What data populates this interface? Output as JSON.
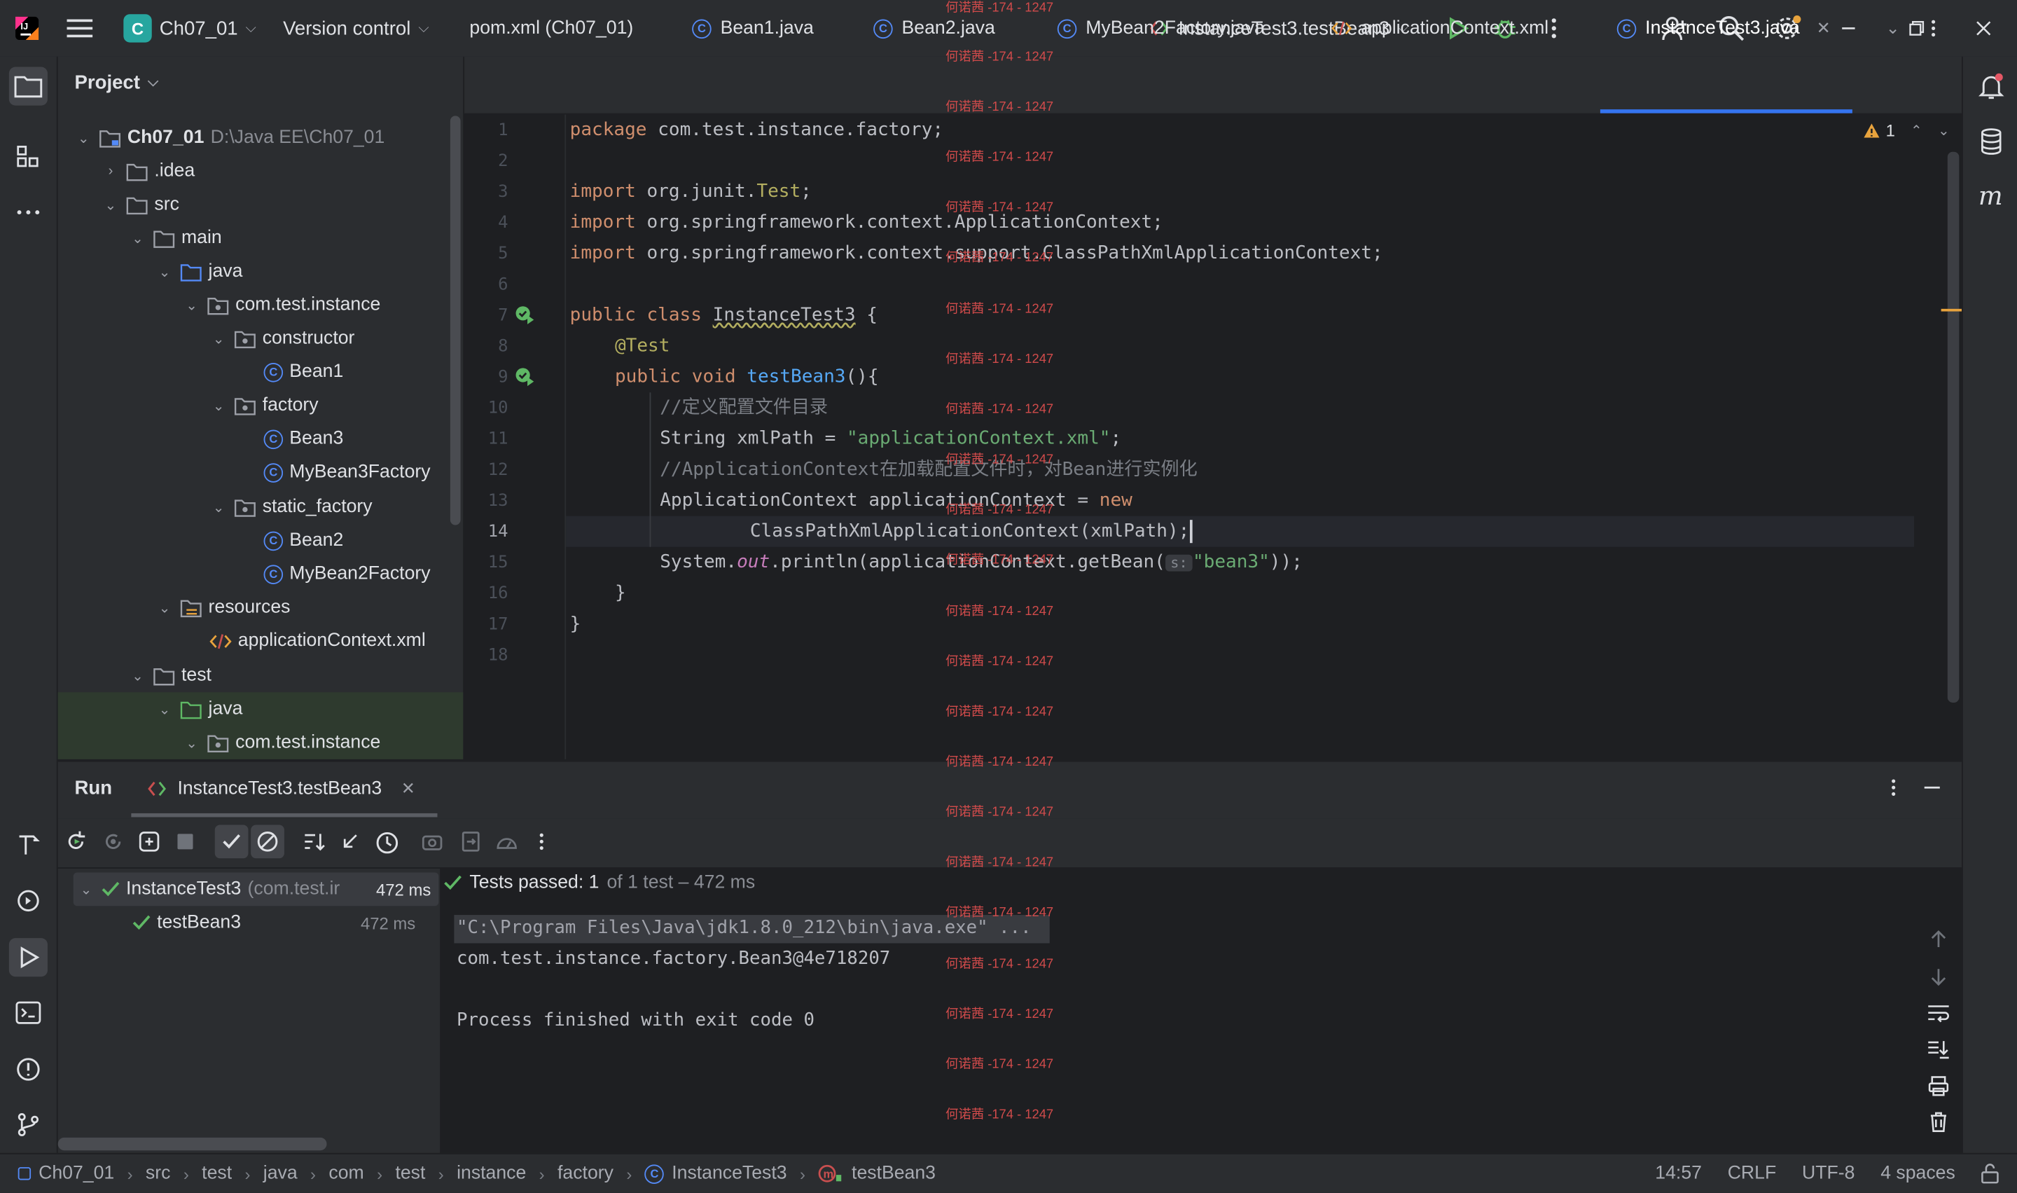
{
  "title_bar": {
    "project_badge": "C",
    "project_name": "Ch07_01",
    "vcs_label": "Version control",
    "run_config": "InstanceTest3.testBean3"
  },
  "project_panel": {
    "title": "Project",
    "tree": [
      {
        "label": "Ch07_01",
        "path": "D:\\Java EE\\Ch07_01"
      },
      {
        "label": ".idea"
      },
      {
        "label": "src"
      },
      {
        "label": "main"
      },
      {
        "label": "java"
      },
      {
        "label": "com.test.instance"
      },
      {
        "label": "constructor"
      },
      {
        "label": "Bean1"
      },
      {
        "label": "factory"
      },
      {
        "label": "Bean3"
      },
      {
        "label": "MyBean3Factory"
      },
      {
        "label": "static_factory"
      },
      {
        "label": "Bean2"
      },
      {
        "label": "MyBean2Factory"
      },
      {
        "label": "resources"
      },
      {
        "label": "applicationContext.xml"
      },
      {
        "label": "test"
      },
      {
        "label": "java"
      },
      {
        "label": "com.test.instance"
      }
    ]
  },
  "tabs": [
    {
      "label": "pom.xml (Ch07_01)"
    },
    {
      "label": "Bean1.java"
    },
    {
      "label": "Bean2.java"
    },
    {
      "label": "MyBean2Factory.java"
    },
    {
      "label": "applicationContext.xml"
    },
    {
      "label": "InstanceTest3.java"
    }
  ],
  "editor": {
    "warning_count": "1",
    "line_numbers": [
      "1",
      "2",
      "3",
      "4",
      "5",
      "6",
      "7",
      "8",
      "9",
      "10",
      "11",
      "12",
      "13",
      "14",
      "15",
      "16",
      "17",
      "18"
    ],
    "lines": {
      "l1_kw": "package",
      "l1_rest": " com.test.instance.factory;",
      "l3_kw": "import",
      "l3_rest": " org.junit.",
      "l3_cls": "Test",
      "l3_end": ";",
      "l4_kw": "import",
      "l4_rest": " org.springframework.context.ApplicationContext;",
      "l5_kw": "import",
      "l5_rest": " org.springframework.context.support.ClassPathXmlApplicationContext;",
      "l7_kw": "public class",
      "l7_cls": "InstanceTest3",
      "l7_end": " {",
      "l8_ann": "@Test",
      "l9_kw": "public void",
      "l9_fn": "testBean3",
      "l9_end": "(){",
      "l10_cmt": "//定义配置文件目录",
      "l11_a": "String xmlPath = ",
      "l11_str": "\"applicationContext.xml\"",
      "l11_end": ";",
      "l12_cmt": "//ApplicationContext在加载配置文件时，对Bean进行实例化",
      "l13_a": "ApplicationContext applicationContext = ",
      "l13_kw": "new",
      "l14_a": "ClassPathXmlApplicationContext(xmlPath);",
      "l15_a": "System.",
      "l15_static": "out",
      "l15_b": ".println(applicationContext.getBean(",
      "l15_hint": "s:",
      "l15_str": "\"bean3\"",
      "l15_end": "));",
      "l16": "}",
      "l17": "}"
    }
  },
  "watermark": "何诺茜 -174 - 1247",
  "run_panel": {
    "title": "Run",
    "tab_label": "InstanceTest3.testBean3",
    "tests_summary_bold": "Tests passed: 1",
    "tests_summary_rest": "of 1 test – 472 ms",
    "tree": [
      {
        "label": "InstanceTest3",
        "sub": "(com.test.ir",
        "time": "472 ms"
      },
      {
        "label": "testBean3",
        "time": "472 ms"
      }
    ],
    "console_lines": [
      "\"C:\\Program Files\\Java\\jdk1.8.0_212\\bin\\java.exe\" ...",
      "com.test.instance.factory.Bean3@4e718207",
      "",
      "Process finished with exit code 0"
    ]
  },
  "status_bar": {
    "breadcrumbs": [
      "Ch07_01",
      "src",
      "test",
      "java",
      "com",
      "test",
      "instance",
      "factory",
      "InstanceTest3",
      "testBean3"
    ],
    "position": "14:57",
    "line_sep": "CRLF",
    "encoding": "UTF-8",
    "indent": "4 spaces"
  },
  "colors": {
    "accent": "#3574f0",
    "keyword": "#cf8e6d",
    "string": "#6aab73",
    "success": "#5fb865",
    "watermark": "#d14b4b"
  }
}
